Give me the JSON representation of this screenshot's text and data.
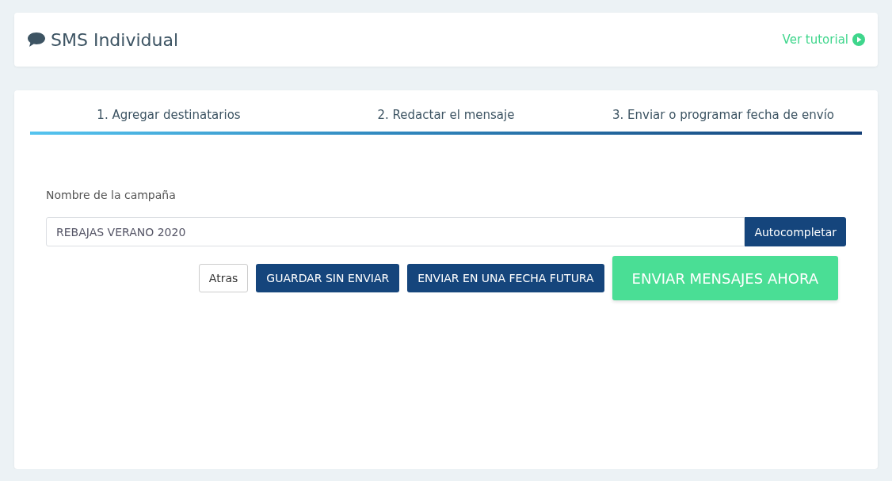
{
  "header": {
    "title": "SMS Individual",
    "tutorial_link": "Ver tutorial"
  },
  "steps": [
    {
      "label": "1. Agregar destinatarios"
    },
    {
      "label": "2. Redactar el mensaje"
    },
    {
      "label": "3. Enviar o programar fecha de envío"
    }
  ],
  "progress": {
    "level": 1
  },
  "campaign": {
    "label": "Nombre de la campaña",
    "value": "REBAJAS VERANO 2020",
    "autocomplete_button": "Autocompletar"
  },
  "buttons": [
    {
      "kind": "plain",
      "label": "Atras"
    },
    {
      "kind": "primary",
      "label": "GUARDAR SIN ENVIAR"
    },
    {
      "kind": "primary",
      "label": "ENVIAR EN UNA FECHA FUTURA"
    },
    {
      "kind": "success",
      "label": "ENVIAR MENSAJES AHORA"
    }
  ]
}
